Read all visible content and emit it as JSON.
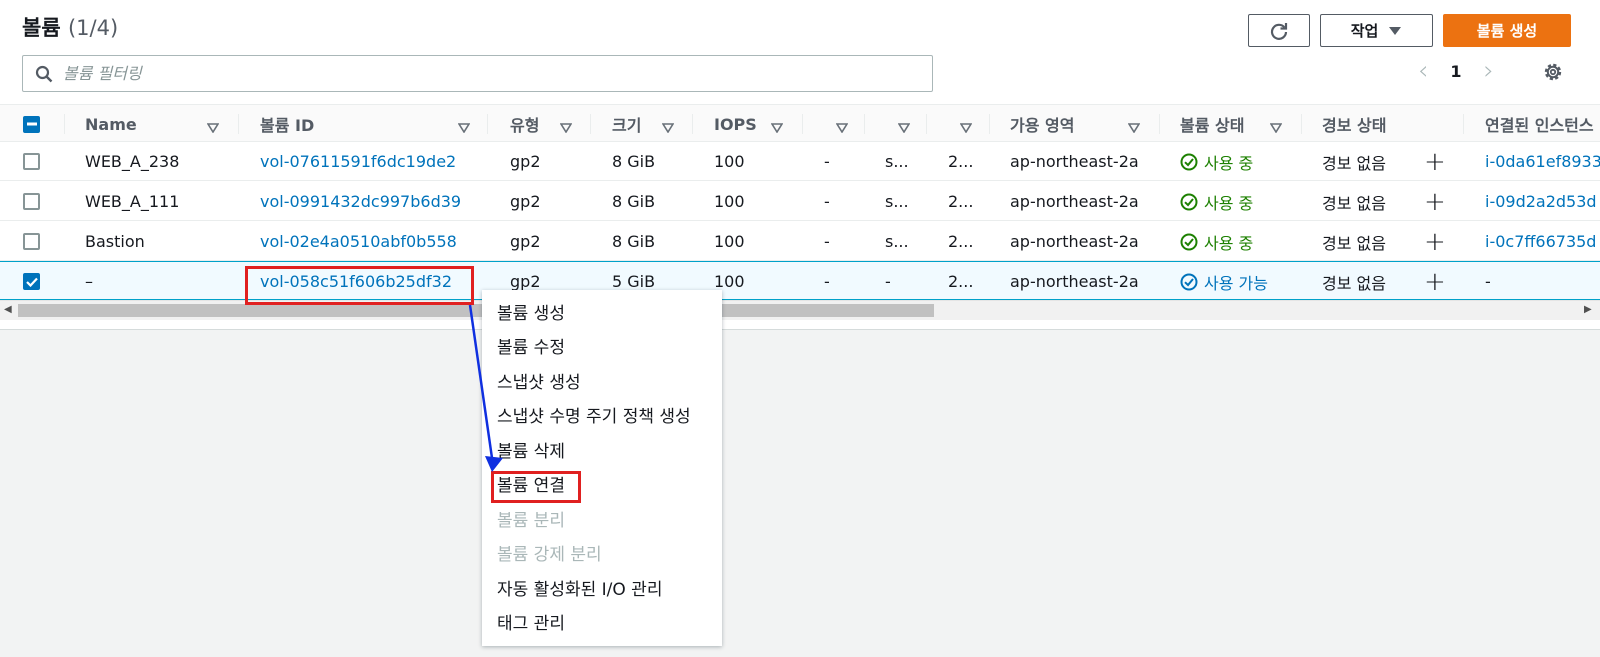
{
  "header": {
    "title": "볼륨",
    "count": "(1/4)",
    "actions_label": "작업",
    "create_label": "볼륨 생성"
  },
  "filter": {
    "placeholder": "볼륨 필터링"
  },
  "pagination": {
    "page": "1"
  },
  "table": {
    "columns": [
      "Name",
      "볼륨 ID",
      "유형",
      "크기",
      "IOPS",
      "",
      "",
      "",
      "가용 영역",
      "볼륨 상태",
      "경보 상태",
      "연결된 인스턴스"
    ],
    "rows": [
      {
        "name": "WEB_A_238",
        "volume_id": "vol-07611591f6dc19de2",
        "type": "gp2",
        "size": "8 GiB",
        "iops": "100",
        "c6": "-",
        "c7": "s...",
        "c8": "2...",
        "az": "ap-northeast-2a",
        "state": "사용 중",
        "alarm": "경보 없음",
        "instance": "i-0da61ef8933",
        "checked": false
      },
      {
        "name": "WEB_A_111",
        "volume_id": "vol-0991432dc997b6d39",
        "type": "gp2",
        "size": "8 GiB",
        "iops": "100",
        "c6": "-",
        "c7": "s...",
        "c8": "2...",
        "az": "ap-northeast-2a",
        "state": "사용 중",
        "alarm": "경보 없음",
        "instance": "i-09d2a2d53d",
        "checked": false
      },
      {
        "name": "Bastion",
        "volume_id": "vol-02e4a0510abf0b558",
        "type": "gp2",
        "size": "8 GiB",
        "iops": "100",
        "c6": "-",
        "c7": "s...",
        "c8": "2...",
        "az": "ap-northeast-2a",
        "state": "사용 중",
        "alarm": "경보 없음",
        "instance": "i-0c7ff66735d",
        "checked": false
      },
      {
        "name": "–",
        "volume_id": "vol-058c51f606b25df32",
        "type": "gp2",
        "size": "5 GiB",
        "iops": "100",
        "c6": "-",
        "c7": "-",
        "c8": "2...",
        "az": "ap-northeast-2a",
        "state": "사용 가능",
        "alarm": "경보 없음",
        "instance": "-",
        "checked": true
      }
    ]
  },
  "context_menu": {
    "items": [
      {
        "label": "볼륨 생성",
        "disabled": false
      },
      {
        "label": "볼륨 수정",
        "disabled": false
      },
      {
        "label": "스냅샷 생성",
        "disabled": false
      },
      {
        "label": "스냅샷 수명 주기 정책 생성",
        "disabled": false
      },
      {
        "label": "볼륨 삭제",
        "disabled": false
      },
      {
        "label": "볼륨 연결",
        "disabled": false
      },
      {
        "label": "볼륨 분리",
        "disabled": true
      },
      {
        "label": "볼륨 강제 분리",
        "disabled": true
      },
      {
        "label": "자동 활성화된 I/O 관리",
        "disabled": false
      },
      {
        "label": "태그 관리",
        "disabled": false
      }
    ]
  },
  "colors": {
    "primary": "#ec7211",
    "link": "#0073bb",
    "success": "#1d8102",
    "annotation": "#e02020",
    "annotation_arrow": "#1030e0"
  }
}
